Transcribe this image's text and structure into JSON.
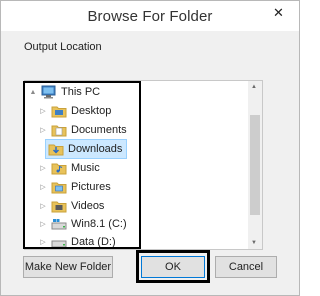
{
  "window": {
    "title": "Browse For Folder"
  },
  "labels": {
    "output_location": "Output Location"
  },
  "tree": {
    "items": [
      {
        "label": "This PC",
        "icon": "computer-icon",
        "expander": "▲"
      },
      {
        "label": "Desktop",
        "icon": "folder-icon",
        "expander": "▷"
      },
      {
        "label": "Documents",
        "icon": "folder-icon",
        "expander": "▷"
      },
      {
        "label": "Downloads",
        "icon": "folder-icon",
        "expander": "",
        "selected": true
      },
      {
        "label": "Music",
        "icon": "folder-icon",
        "expander": "▷"
      },
      {
        "label": "Pictures",
        "icon": "folder-icon",
        "expander": "▷"
      },
      {
        "label": "Videos",
        "icon": "folder-icon",
        "expander": "▷"
      },
      {
        "label": "Win8.1 (C:)",
        "icon": "drive-icon",
        "expander": "▷"
      },
      {
        "label": "Data (D:)",
        "icon": "drive-icon",
        "expander": "▷"
      }
    ]
  },
  "buttons": {
    "make_new_folder": "Make New Folder",
    "ok": "OK",
    "cancel": "Cancel"
  },
  "colors": {
    "selection_bg": "#cce8ff",
    "folder": "#e8c25a",
    "highlight_border": "#000000"
  }
}
